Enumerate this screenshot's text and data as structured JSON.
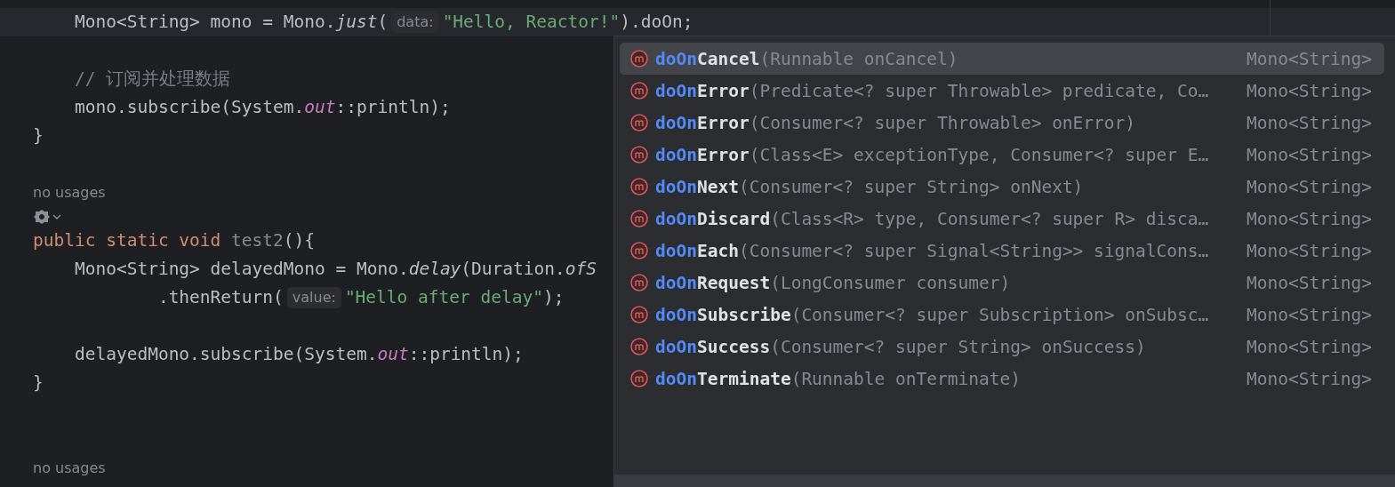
{
  "editor": {
    "lines": [
      {
        "kind": "code",
        "current": true,
        "tokens": [
          {
            "kind": "plain",
            "text": "    Mono<String> mono = Mono."
          },
          {
            "kind": "static",
            "text": "just"
          },
          {
            "kind": "plain",
            "text": "("
          },
          {
            "kind": "hint",
            "text": "data:"
          },
          {
            "kind": "string",
            "text": "\"Hello, Reactor!\""
          },
          {
            "kind": "plain",
            "text": ").doOn;"
          }
        ]
      },
      {
        "kind": "blank"
      },
      {
        "kind": "code",
        "current": false,
        "tokens": [
          {
            "kind": "comment",
            "text": "    // 订阅并处理数据"
          }
        ]
      },
      {
        "kind": "code",
        "current": false,
        "tokens": [
          {
            "kind": "plain",
            "text": "    mono.subscribe(System."
          },
          {
            "kind": "field",
            "text": "out"
          },
          {
            "kind": "plain",
            "text": "::println);"
          }
        ]
      },
      {
        "kind": "code",
        "current": false,
        "tokens": [
          {
            "kind": "plain",
            "text": "}"
          }
        ]
      },
      {
        "kind": "blank"
      },
      {
        "kind": "meta",
        "text": "no usages"
      },
      {
        "kind": "gutter"
      },
      {
        "kind": "code",
        "current": false,
        "tokens": [
          {
            "kind": "keyword",
            "text": "public static void "
          },
          {
            "kind": "unused",
            "text": "test2"
          },
          {
            "kind": "plain",
            "text": "(){"
          }
        ]
      },
      {
        "kind": "code",
        "current": false,
        "tokens": [
          {
            "kind": "plain",
            "text": "    Mono<String> delayedMono = Mono."
          },
          {
            "kind": "static",
            "text": "delay"
          },
          {
            "kind": "plain",
            "text": "(Duration."
          },
          {
            "kind": "static",
            "text": "ofS"
          }
        ]
      },
      {
        "kind": "code",
        "current": false,
        "tokens": [
          {
            "kind": "plain",
            "text": "            .thenReturn("
          },
          {
            "kind": "hint",
            "text": "value:"
          },
          {
            "kind": "string",
            "text": "\"Hello after delay\""
          },
          {
            "kind": "plain",
            "text": ");"
          }
        ]
      },
      {
        "kind": "blank"
      },
      {
        "kind": "code",
        "current": false,
        "tokens": [
          {
            "kind": "plain",
            "text": "    delayedMono.subscribe(System."
          },
          {
            "kind": "field",
            "text": "out"
          },
          {
            "kind": "plain",
            "text": "::println);"
          }
        ]
      },
      {
        "kind": "code",
        "current": false,
        "tokens": [
          {
            "kind": "plain",
            "text": "}"
          }
        ]
      },
      {
        "kind": "blank"
      },
      {
        "kind": "blank"
      },
      {
        "kind": "meta",
        "text": "no usages"
      }
    ]
  },
  "completion": {
    "items": [
      {
        "prefix": "doOn",
        "rest": "Cancel",
        "params": "(Runnable onCancel)",
        "type": "Mono<String>",
        "selected": true
      },
      {
        "prefix": "doOn",
        "rest": "Error",
        "params": "(Predicate<? super Throwable> predicate, Co…",
        "type": "Mono<String>",
        "selected": false
      },
      {
        "prefix": "doOn",
        "rest": "Error",
        "params": "(Consumer<? super Throwable> onError)",
        "type": "Mono<String>",
        "selected": false
      },
      {
        "prefix": "doOn",
        "rest": "Error",
        "params": "(Class<E> exceptionType, Consumer<? super E…",
        "type": "Mono<String>",
        "selected": false
      },
      {
        "prefix": "doOn",
        "rest": "Next",
        "params": "(Consumer<? super String> onNext)",
        "type": "Mono<String>",
        "selected": false
      },
      {
        "prefix": "doOn",
        "rest": "Discard",
        "params": "(Class<R> type, Consumer<? super R> disca…",
        "type": "Mono<String>",
        "selected": false
      },
      {
        "prefix": "doOn",
        "rest": "Each",
        "params": "(Consumer<? super Signal<String>> signalCons…",
        "type": "Mono<String>",
        "selected": false
      },
      {
        "prefix": "doOn",
        "rest": "Request",
        "params": "(LongConsumer consumer)",
        "type": "Mono<String>",
        "selected": false
      },
      {
        "prefix": "doOn",
        "rest": "Subscribe",
        "params": "(Consumer<? super Subscription> onSubsc…",
        "type": "Mono<String>",
        "selected": false
      },
      {
        "prefix": "doOn",
        "rest": "Success",
        "params": "(Consumer<? super String> onSuccess)",
        "type": "Mono<String>",
        "selected": false
      },
      {
        "prefix": "doOn",
        "rest": "Terminate",
        "params": "(Runnable onTerminate)",
        "type": "Mono<String>",
        "selected": false
      }
    ]
  }
}
